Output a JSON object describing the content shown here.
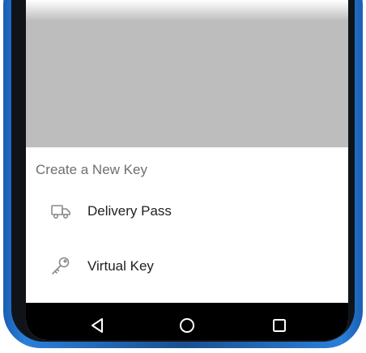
{
  "sheet": {
    "title": "Create a New Key",
    "items": [
      {
        "label": "Delivery Pass",
        "icon": "truck-icon"
      },
      {
        "label": "Virtual Key",
        "icon": "key-icon"
      }
    ]
  },
  "nav_bar": {
    "buttons": [
      "back-icon",
      "home-icon",
      "recents-icon"
    ]
  },
  "colors": {
    "frame_accent": "#2a7fd8",
    "scrim": "#bdbdbd",
    "icon": "#8a8a8a"
  }
}
